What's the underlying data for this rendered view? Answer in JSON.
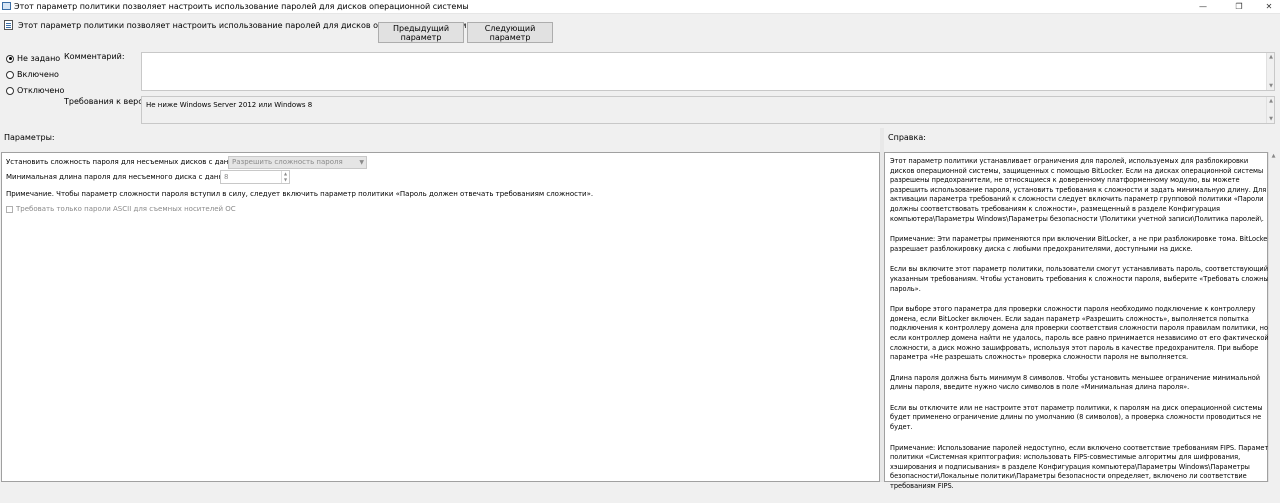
{
  "window": {
    "title": "Этот параметр политики позволяет настроить использование паролей для дисков операционной системы",
    "minimize_glyph": "—",
    "restore_glyph": "❐",
    "close_glyph": "✕"
  },
  "header": {
    "title": "Этот параметр политики позволяет настроить использование паролей для дисков операционной системы",
    "prev_button": "Предыдущий параметр",
    "next_button": "Следующий параметр"
  },
  "state": {
    "options": [
      {
        "label": "Не задано",
        "checked": true
      },
      {
        "label": "Включено",
        "checked": false
      },
      {
        "label": "Отключено",
        "checked": false
      }
    ]
  },
  "comment": {
    "label": "Комментарий:",
    "value": ""
  },
  "supported": {
    "label": "Требования к версии:",
    "value": "Не ниже Windows Server 2012 или Windows 8"
  },
  "sections": {
    "options_label": "Параметры:",
    "help_label": "Справка:"
  },
  "options_panel": {
    "complexity_label": "Установить сложность пароля для несъемных дисков с данными:",
    "complexity_value": "Разрешить сложность пароля",
    "min_length_label": "Минимальная длина пароля для несъемного диска с данными:",
    "min_length_value": "8",
    "note": "Примечание. Чтобы параметр сложности пароля вступил в силу, следует включить параметр политики «Пароль должен отвечать требованиям сложности».",
    "ascii_label": "Требовать только пароли ASCII для съемных носителей ОС",
    "ascii_checked": false
  },
  "help": {
    "paragraphs": [
      "Этот параметр политики устанавливает ограничения для паролей, используемых для разблокировки дисков операционной системы, защищенных с помощью BitLocker. Если на дисках операционной системы разрешены предохранители, не относящиеся к доверенному платформенному модулю, вы можете разрешить использование пароля, установить требования к сложности и задать минимальную длину. Для активации параметра требований к сложности следует включить параметр групповой политики «Пароли должны соответствовать требованиям к сложности», размещенный в разделе Конфигурация компьютера\\Параметры Windows\\Параметры безопасности \\Политики учетной записи\\Политика паролей\\.",
      "Примечание: Эти параметры применяются при включении BitLocker, а не при разблокировке тома. BitLocker разрешает разблокировку диска с любыми предохранителями, доступными на диске.",
      "Если вы включите этот параметр политики, пользователи смогут устанавливать пароль, соответствующий указанным требованиям. Чтобы установить требования к сложности пароля, выберите «Требовать сложный пароль».",
      "При выборе этого параметра для проверки сложности пароля необходимо подключение к контроллеру домена, если BitLocker включен. Если задан параметр «Разрешить сложность», выполняется попытка подключения к контроллеру домена для проверки соответствия сложности пароля правилам политики, но, если контроллер домена найти не удалось, пароль все равно принимается независимо от его фактической сложности, а диск можно зашифровать, используя этот пароль в качестве предохранителя. При выборе параметра «Не разрешать сложность» проверка сложности пароля не выполняется.",
      "Длина пароля должна быть минимум 8 символов. Чтобы установить меньшее ограничение минимальной длины пароля, введите нужно число символов в поле «Минимальная длина пароля».",
      "Если вы отключите или не настроите этот параметр политики, к паролям на диск операционной системы будет применено ограничение длины по умолчанию (8 символов), а проверка сложности проводиться не будет.",
      "Примечание: Использование паролей недоступно, если включено соответствие требованиям FIPS. Параметр политики «Системная криптография: использовать FIPS-совместимые алгоритмы для шифрования, хэширования и подписывания» в разделе Конфигурация компьютера\\Параметры Windows\\Параметры безопасности\\Локальные политики\\Параметры безопасности определяет, включено ли соответствие требованиям FIPS."
    ]
  }
}
